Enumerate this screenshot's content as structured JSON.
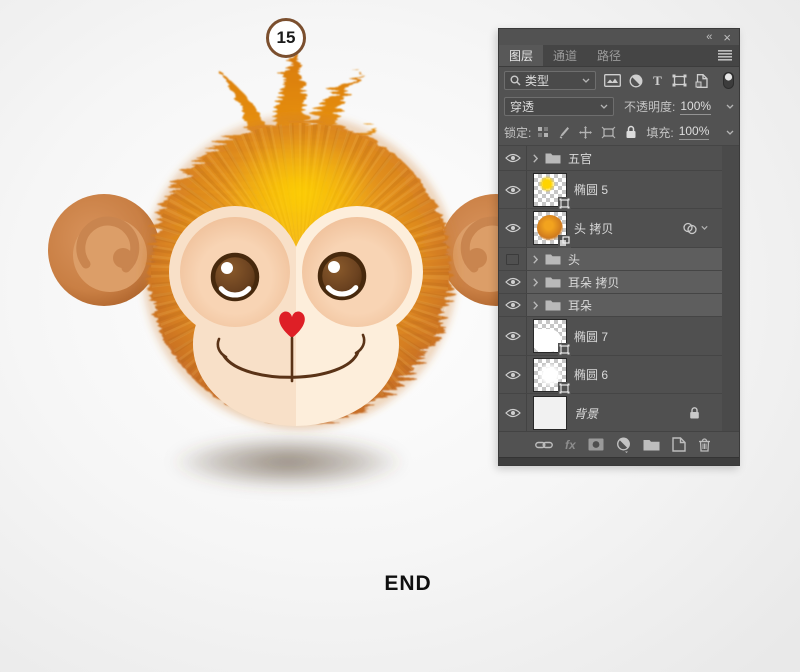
{
  "canvas": {
    "step_number": "15",
    "end_label": "END",
    "artwork": "fuzzy orange monkey head illustration with brown ears, cream face, brown eyes, red heart nose, smile, soft drop shadow"
  },
  "colors": {
    "panel_bg": "#525252",
    "row_bg": "#505050",
    "row_selected": "#5e5e5e",
    "fur_mid": "#e6941c",
    "fur_edge": "#bb6128",
    "crown_highlight": "#ffd400",
    "ear_outer": "#c97f44",
    "ear_inner": "#dc9e68",
    "face_cream": "#fdeedb",
    "eye_socket": "#f5cbaa",
    "iris_brown": "#6b4220",
    "nose_red": "#de1f26",
    "mouth_stroke": "#5a3317",
    "step_ring": "#7b4f2e"
  },
  "layers_panel": {
    "window_controls": {
      "collapse": "«",
      "close": "×"
    },
    "tabs": [
      {
        "label": "图层",
        "active": true
      },
      {
        "label": "通道",
        "active": false
      },
      {
        "label": "路径",
        "active": false
      }
    ],
    "menu_icon": "panel-menu-icon",
    "filter": {
      "search_label": "类型",
      "filter_icons": [
        "pixel-layer-filter-icon",
        "adjustment-layer-filter-icon",
        "type-layer-filter-icon",
        "shape-layer-filter-icon",
        "smart-object-filter-icon",
        "filter-toggle-pill"
      ]
    },
    "blend": {
      "mode": "穿透",
      "opacity_label": "不透明度:",
      "opacity_value": "100%"
    },
    "lock": {
      "label": "锁定:",
      "lock_icons": [
        "lock-transparency-icon",
        "lock-pixels-icon",
        "lock-position-icon",
        "lock-artboard-icon",
        "lock-all-icon"
      ],
      "fill_label": "填充:",
      "fill_value": "100%"
    },
    "rows": [
      {
        "type": "group",
        "name": "五官",
        "visible": true,
        "selected": false
      },
      {
        "type": "layer",
        "name": "椭圆 5",
        "visible": true,
        "selected": false,
        "thumb": "yellow-ellipse",
        "badge": "shape-layer"
      },
      {
        "type": "layer",
        "name": "头 拷贝",
        "visible": true,
        "selected": false,
        "thumb": "orange-head",
        "badge": "smart-object",
        "right_badge": "effects"
      },
      {
        "type": "group",
        "name": "头",
        "visible": false,
        "selected": true
      },
      {
        "type": "group",
        "name": "耳朵 拷贝",
        "visible": true,
        "selected": true
      },
      {
        "type": "group",
        "name": "耳朵",
        "visible": true,
        "selected": true
      },
      {
        "type": "layer",
        "name": "椭圆 7",
        "visible": true,
        "selected": false,
        "thumb": "white-shape",
        "badge": "shape-layer"
      },
      {
        "type": "layer",
        "name": "椭圆 6",
        "visible": true,
        "selected": false,
        "thumb": "white-fuzzy",
        "badge": "shape-layer"
      },
      {
        "type": "layer",
        "name": "背景",
        "visible": true,
        "selected": false,
        "thumb": "solid-white",
        "locked": true,
        "italic": true
      }
    ],
    "footer": {
      "fx_label": "fx",
      "icons": [
        "link-layers-icon",
        "layer-style-icon",
        "add-layer-mask-icon",
        "adjustment-layer-icon",
        "new-group-icon",
        "new-layer-icon",
        "delete-layer-icon"
      ]
    }
  }
}
